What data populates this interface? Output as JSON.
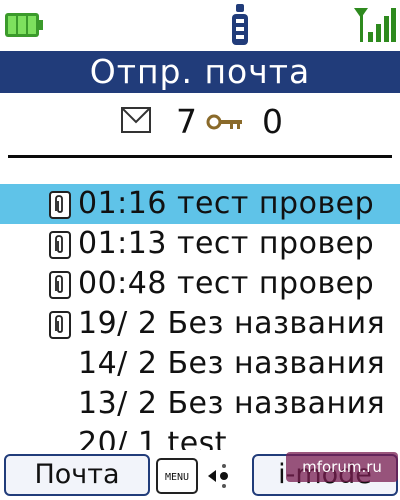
{
  "status_bar": {
    "battery_icon": "battery-full-icon",
    "mode_icon": "i-mode-indicator-icon",
    "signal_icon": "signal-strength-icon"
  },
  "title": "Отпр. почта",
  "counters": {
    "mail_icon": "envelope-icon",
    "mail_count": "7",
    "lock_icon": "key-icon",
    "protected_count": "0"
  },
  "mail_list": {
    "selected_index": 0,
    "items": [
      {
        "text": "01:16 тест  провер",
        "attachment": true
      },
      {
        "text": "01:13 тест  провер",
        "attachment": true
      },
      {
        "text": "00:48 тест  провер",
        "attachment": true
      },
      {
        "text": "19/ 2 Без названия",
        "attachment": true
      },
      {
        "text": "14/ 2 Без названия",
        "attachment": false
      },
      {
        "text": "13/ 2 Без названия",
        "attachment": false
      },
      {
        "text": "20/ 1 test",
        "attachment": false
      }
    ]
  },
  "softkeys": {
    "left_label": "Почта",
    "menu_label": "MENU",
    "right_label": "i-mode"
  },
  "watermark": "mforum.ru",
  "colors": {
    "title_bar": "#213c7a",
    "selection": "#5fc3e8",
    "battery": "#4cba3a"
  }
}
